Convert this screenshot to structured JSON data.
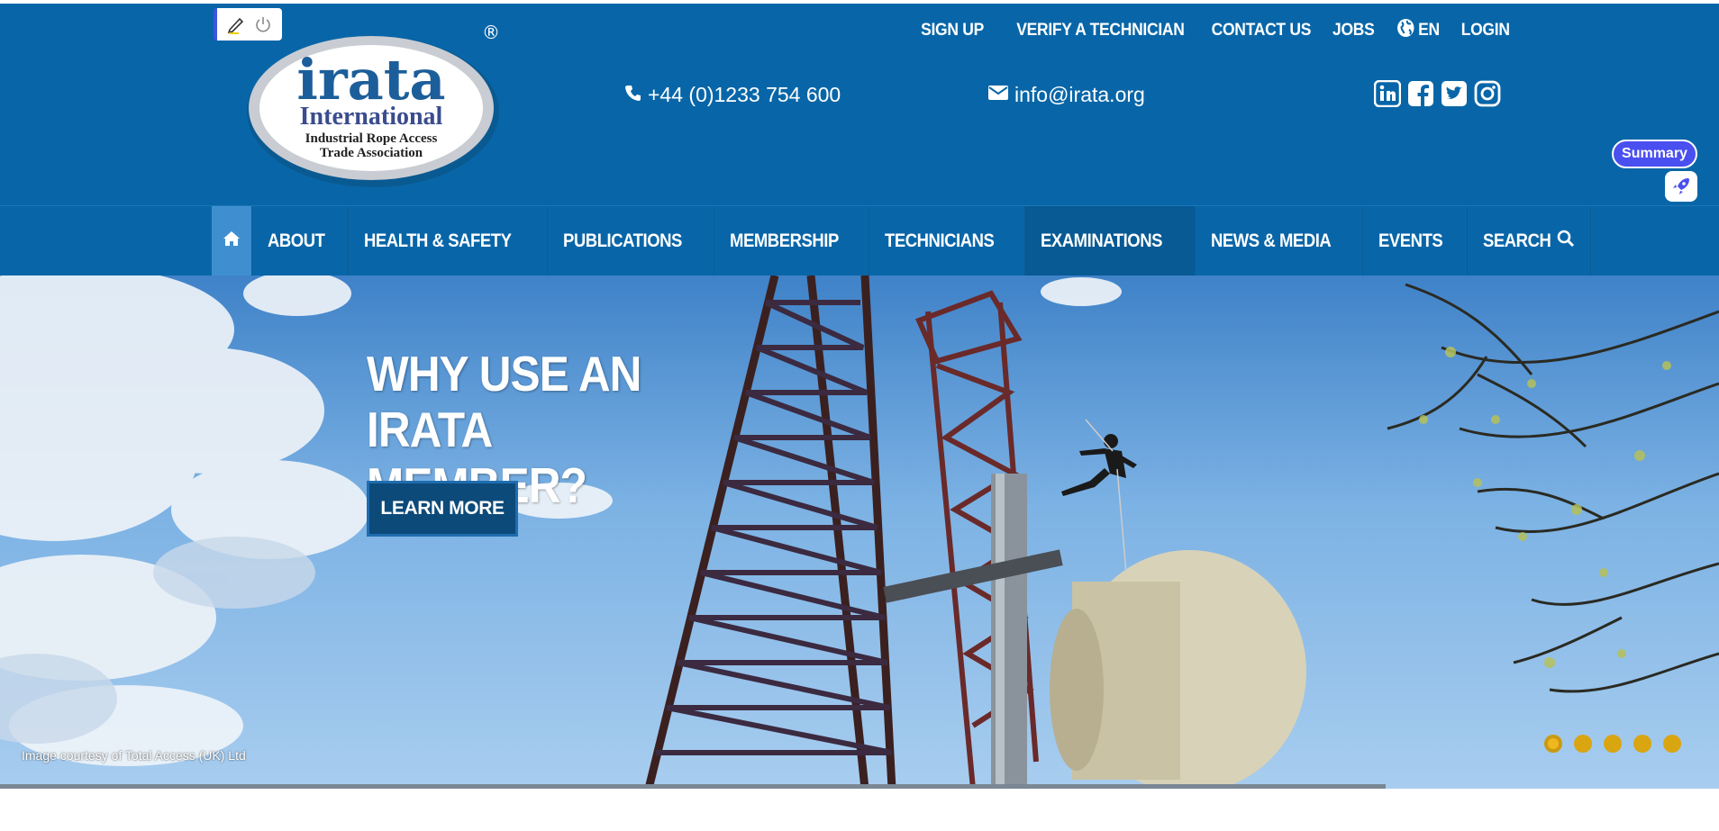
{
  "brand": {
    "logo_word": "irata",
    "logo_sub": "International",
    "logo_line1": "Industrial Rope Access",
    "logo_line2": "Trade Association",
    "registered": "®"
  },
  "top_links": [
    {
      "label": "SIGN UP"
    },
    {
      "label": "VERIFY A TECHNICIAN"
    },
    {
      "label": "CONTACT US"
    },
    {
      "label": "JOBS"
    },
    {
      "label": "EN",
      "icon": "globe-icon"
    },
    {
      "label": "LOGIN"
    }
  ],
  "contact": {
    "phone": "+44 (0)1233 754 600",
    "email": "info@irata.org"
  },
  "social": [
    "linkedin-icon",
    "facebook-icon",
    "twitter-icon",
    "instagram-icon"
  ],
  "summary_widget": {
    "label": "Summary"
  },
  "nav": {
    "home_icon": "home-icon",
    "items": [
      {
        "label": "ABOUT"
      },
      {
        "label": "HEALTH & SAFETY"
      },
      {
        "label": "PUBLICATIONS"
      },
      {
        "label": "MEMBERSHIP"
      },
      {
        "label": "TECHNICIANS"
      },
      {
        "label": "EXAMINATIONS"
      },
      {
        "label": "NEWS & MEDIA"
      },
      {
        "label": "EVENTS"
      },
      {
        "label": "SEARCH",
        "icon": "search-icon"
      }
    ]
  },
  "hero": {
    "title_line1": "WHY USE AN IRATA",
    "title_line2": "MEMBER?",
    "button": "LEARN MORE",
    "credit": "Image courtesy of Total Access (UK) Ltd",
    "slide_count": 5,
    "active_slide": 1
  },
  "colors": {
    "header_bg": "#0866a8",
    "nav_home_bg": "#3f8fd0",
    "button_bg": "#0c4a79",
    "dot": "#d9a511",
    "summary": "#4a4ff0"
  }
}
